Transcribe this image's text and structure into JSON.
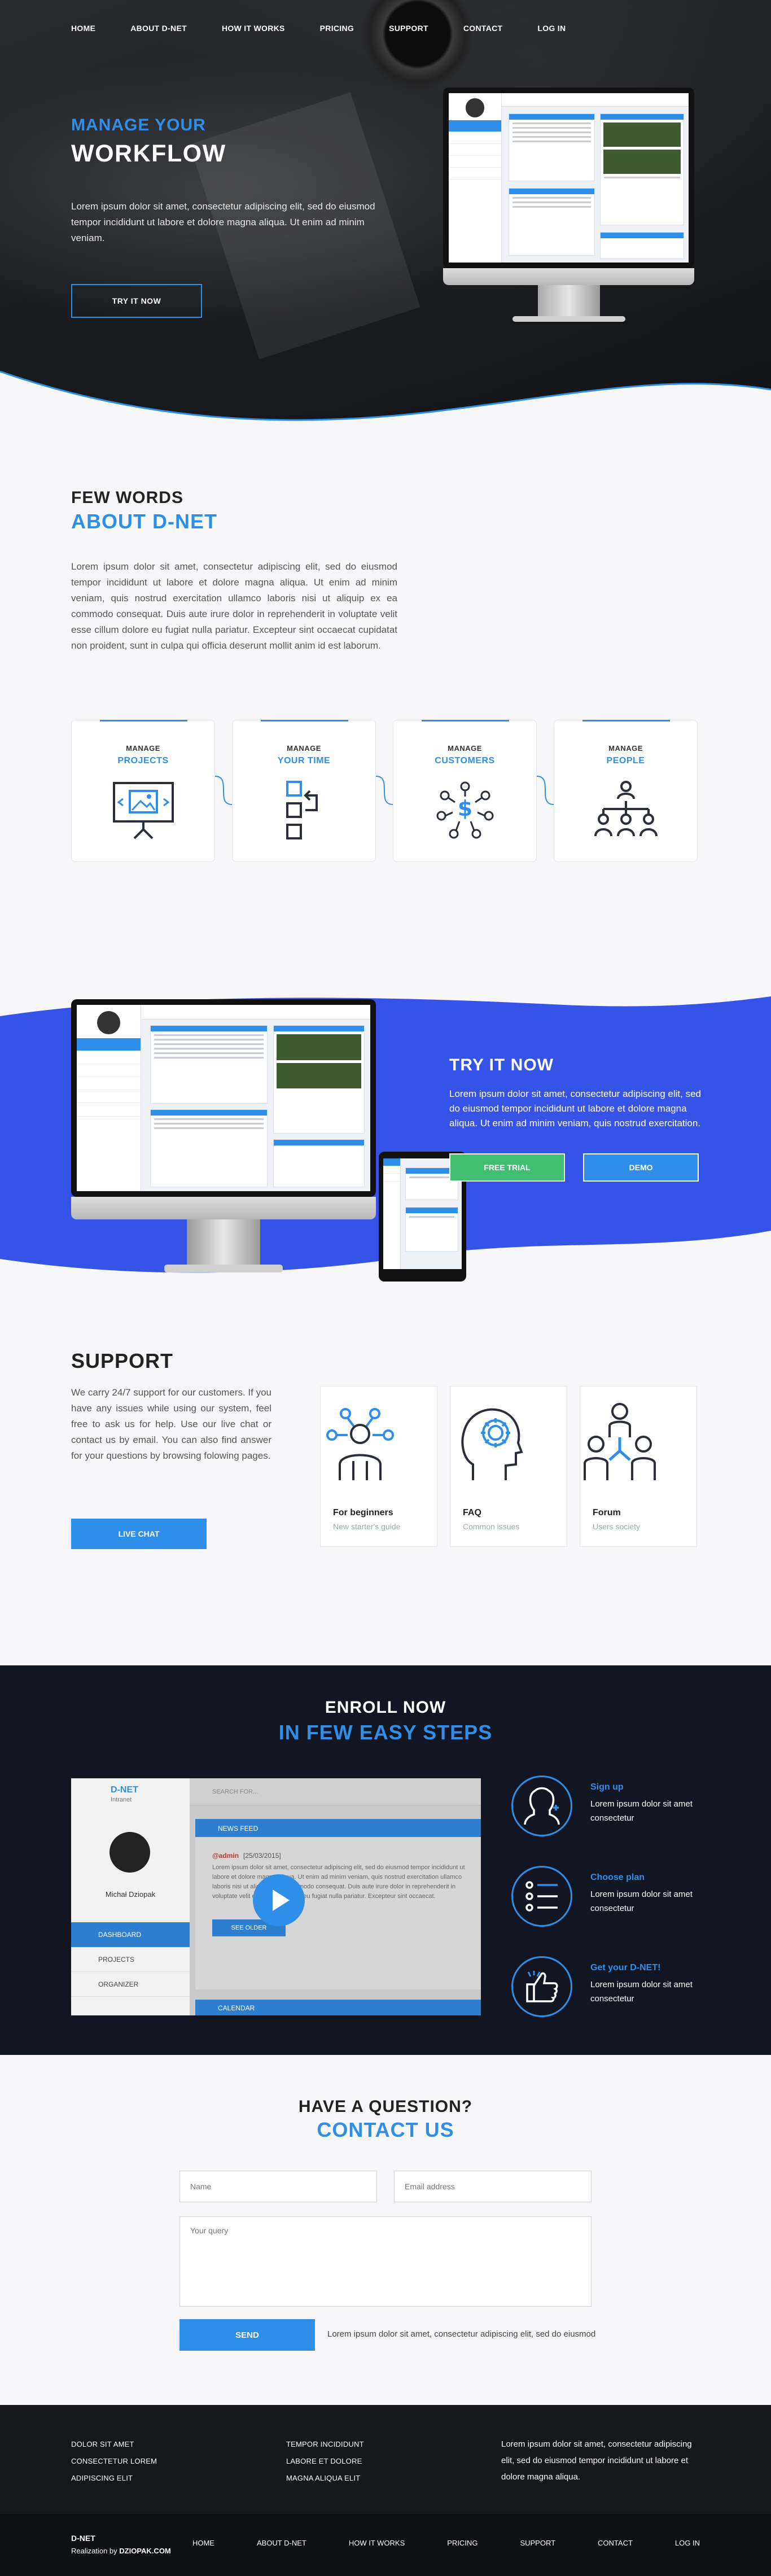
{
  "nav": {
    "items": [
      "HOME",
      "ABOUT D-NET",
      "HOW IT WORKS",
      "PRICING",
      "SUPPORT",
      "CONTACT",
      "LOG IN"
    ]
  },
  "hero": {
    "subtitle": "MANAGE YOUR",
    "title": "WORKFLOW",
    "text": "Lorem ipsum dolor sit amet, consectetur adipiscing elit, sed do eiusmod tempor incididunt ut labore et dolore magna aliqua. Ut enim ad minim veniam.",
    "button": "TRY IT NOW"
  },
  "about": {
    "kicker": "FEW WORDS",
    "title": "ABOUT D-NET",
    "text": "Lorem ipsum dolor sit amet, consectetur adipiscing elit, sed do eiusmod tempor incididunt ut labore et dolore magna aliqua. Ut enim ad minim veniam, quis nostrud exercitation ullamco laboris nisi ut aliquip ex ea commodo consequat. Duis aute irure dolor in reprehenderit in voluptate velit esse cillum dolore eu fugiat nulla pariatur. Excepteur sint occaecat cupidatat non proident, sunt in culpa qui officia deserunt mollit anim id est laborum.",
    "features": [
      {
        "top": "MANAGE",
        "bottom": "PROJECTS",
        "icon": "presentation-icon"
      },
      {
        "top": "MANAGE",
        "bottom": "YOUR TIME",
        "icon": "workflow-icon"
      },
      {
        "top": "MANAGE",
        "bottom": "CUSTOMERS",
        "icon": "money-network-icon"
      },
      {
        "top": "MANAGE",
        "bottom": "PEOPLE",
        "icon": "org-chart-icon"
      }
    ]
  },
  "try": {
    "title": "TRY IT NOW",
    "text": "Lorem ipsum dolor sit amet, consectetur adipiscing elit, sed do eiusmod tempor incididunt ut labore et dolore magna aliqua. Ut enim ad minim veniam, quis nostrud exercitation.",
    "trial": "FREE TRIAL",
    "demo": "DEMO"
  },
  "support": {
    "title": "SUPPORT",
    "text": "We carry 24/7 support for our customers. If you have any issues while using our system, feel free to ask us for help. Use our live chat or contact us by email. You can also find answer for your questions by browsing folowing pages.",
    "button": "LIVE CHAT",
    "cards": [
      {
        "title": "For beginners",
        "sub": "New starter's guide",
        "icon": "beginner-network-icon"
      },
      {
        "title": "FAQ",
        "sub": "Common issues",
        "icon": "head-gear-icon"
      },
      {
        "title": "Forum",
        "sub": "Users society",
        "icon": "community-icon"
      }
    ]
  },
  "enroll": {
    "kicker": "ENROLL NOW",
    "title": "IN FEW EASY STEPS",
    "video": {
      "brand": "D-NET",
      "brand_sub": "Intranet",
      "user": "Michał Dziopak",
      "menu": [
        "DASHBOARD",
        "PROJECTS",
        "ORGANIZER"
      ],
      "search": "SEARCH FOR...",
      "feed_title": "NEWS FEED",
      "post_author": "@admin",
      "post_date": "[25/03/2015]",
      "post_text": "Lorem ipsum dolor sit amet, consectetur adipiscing elit, sed do eiusmod tempor incididunt ut labore et dolore magna aliqua. Ut enim ad minim veniam, quis nostrud exercitation ullamco laboris nisi ut aliquip ex ea commodo consequat. Duis aute irure dolor in reprehenderit in voluptate velit esse cillum dolore eu fugiat nulla pariatur. Excepteur sint occaecat.",
      "older": "SEE OLDER",
      "calendar": "CALENDAR"
    },
    "steps": [
      {
        "title": "Sign up",
        "text": "Lorem ipsum dolor sit amet consectetur",
        "icon": "add-user-icon"
      },
      {
        "title": "Choose plan",
        "text": "Lorem ipsum dolor sit amet consectetur",
        "icon": "checklist-icon"
      },
      {
        "title": "Get your D-NET!",
        "text": "Lorem ipsum dolor sit amet consectetur",
        "icon": "thumbs-up-icon"
      }
    ]
  },
  "contact": {
    "kicker": "HAVE A QUESTION?",
    "title": "CONTACT US",
    "name_placeholder": "Name",
    "email_placeholder": "Email address",
    "query_placeholder": "Your query",
    "send": "SEND",
    "note": "Lorem ipsum dolor sit amet, consectetur adipiscing elit, sed do eiusmod"
  },
  "footer": {
    "col1": [
      "DOLOR SIT AMET",
      "CONSECTETUR LOREM",
      "ADIPISCING ELIT"
    ],
    "col2": [
      "TEMPOR INCIDIDUNT",
      "LABORE ET DOLORE",
      "MAGNA ALIQUA ELIT"
    ],
    "text": "Lorem ipsum dolor sit amet, consectetur adipiscing elit, sed do eiusmod tempor incididunt ut labore et dolore magna aliqua.",
    "brand": "D-NET",
    "credit_prefix": "Realization by",
    "credit_name": "DZIOPAK.COM",
    "nav": [
      "HOME",
      "ABOUT D-NET",
      "HOW IT WORKS",
      "PRICING",
      "SUPPORT",
      "CONTACT",
      "LOG IN"
    ]
  },
  "colors": {
    "accent": "#2f8fe8",
    "try_bg": "#3653e8",
    "dark": "#121622",
    "green": "#3fbf6f"
  }
}
